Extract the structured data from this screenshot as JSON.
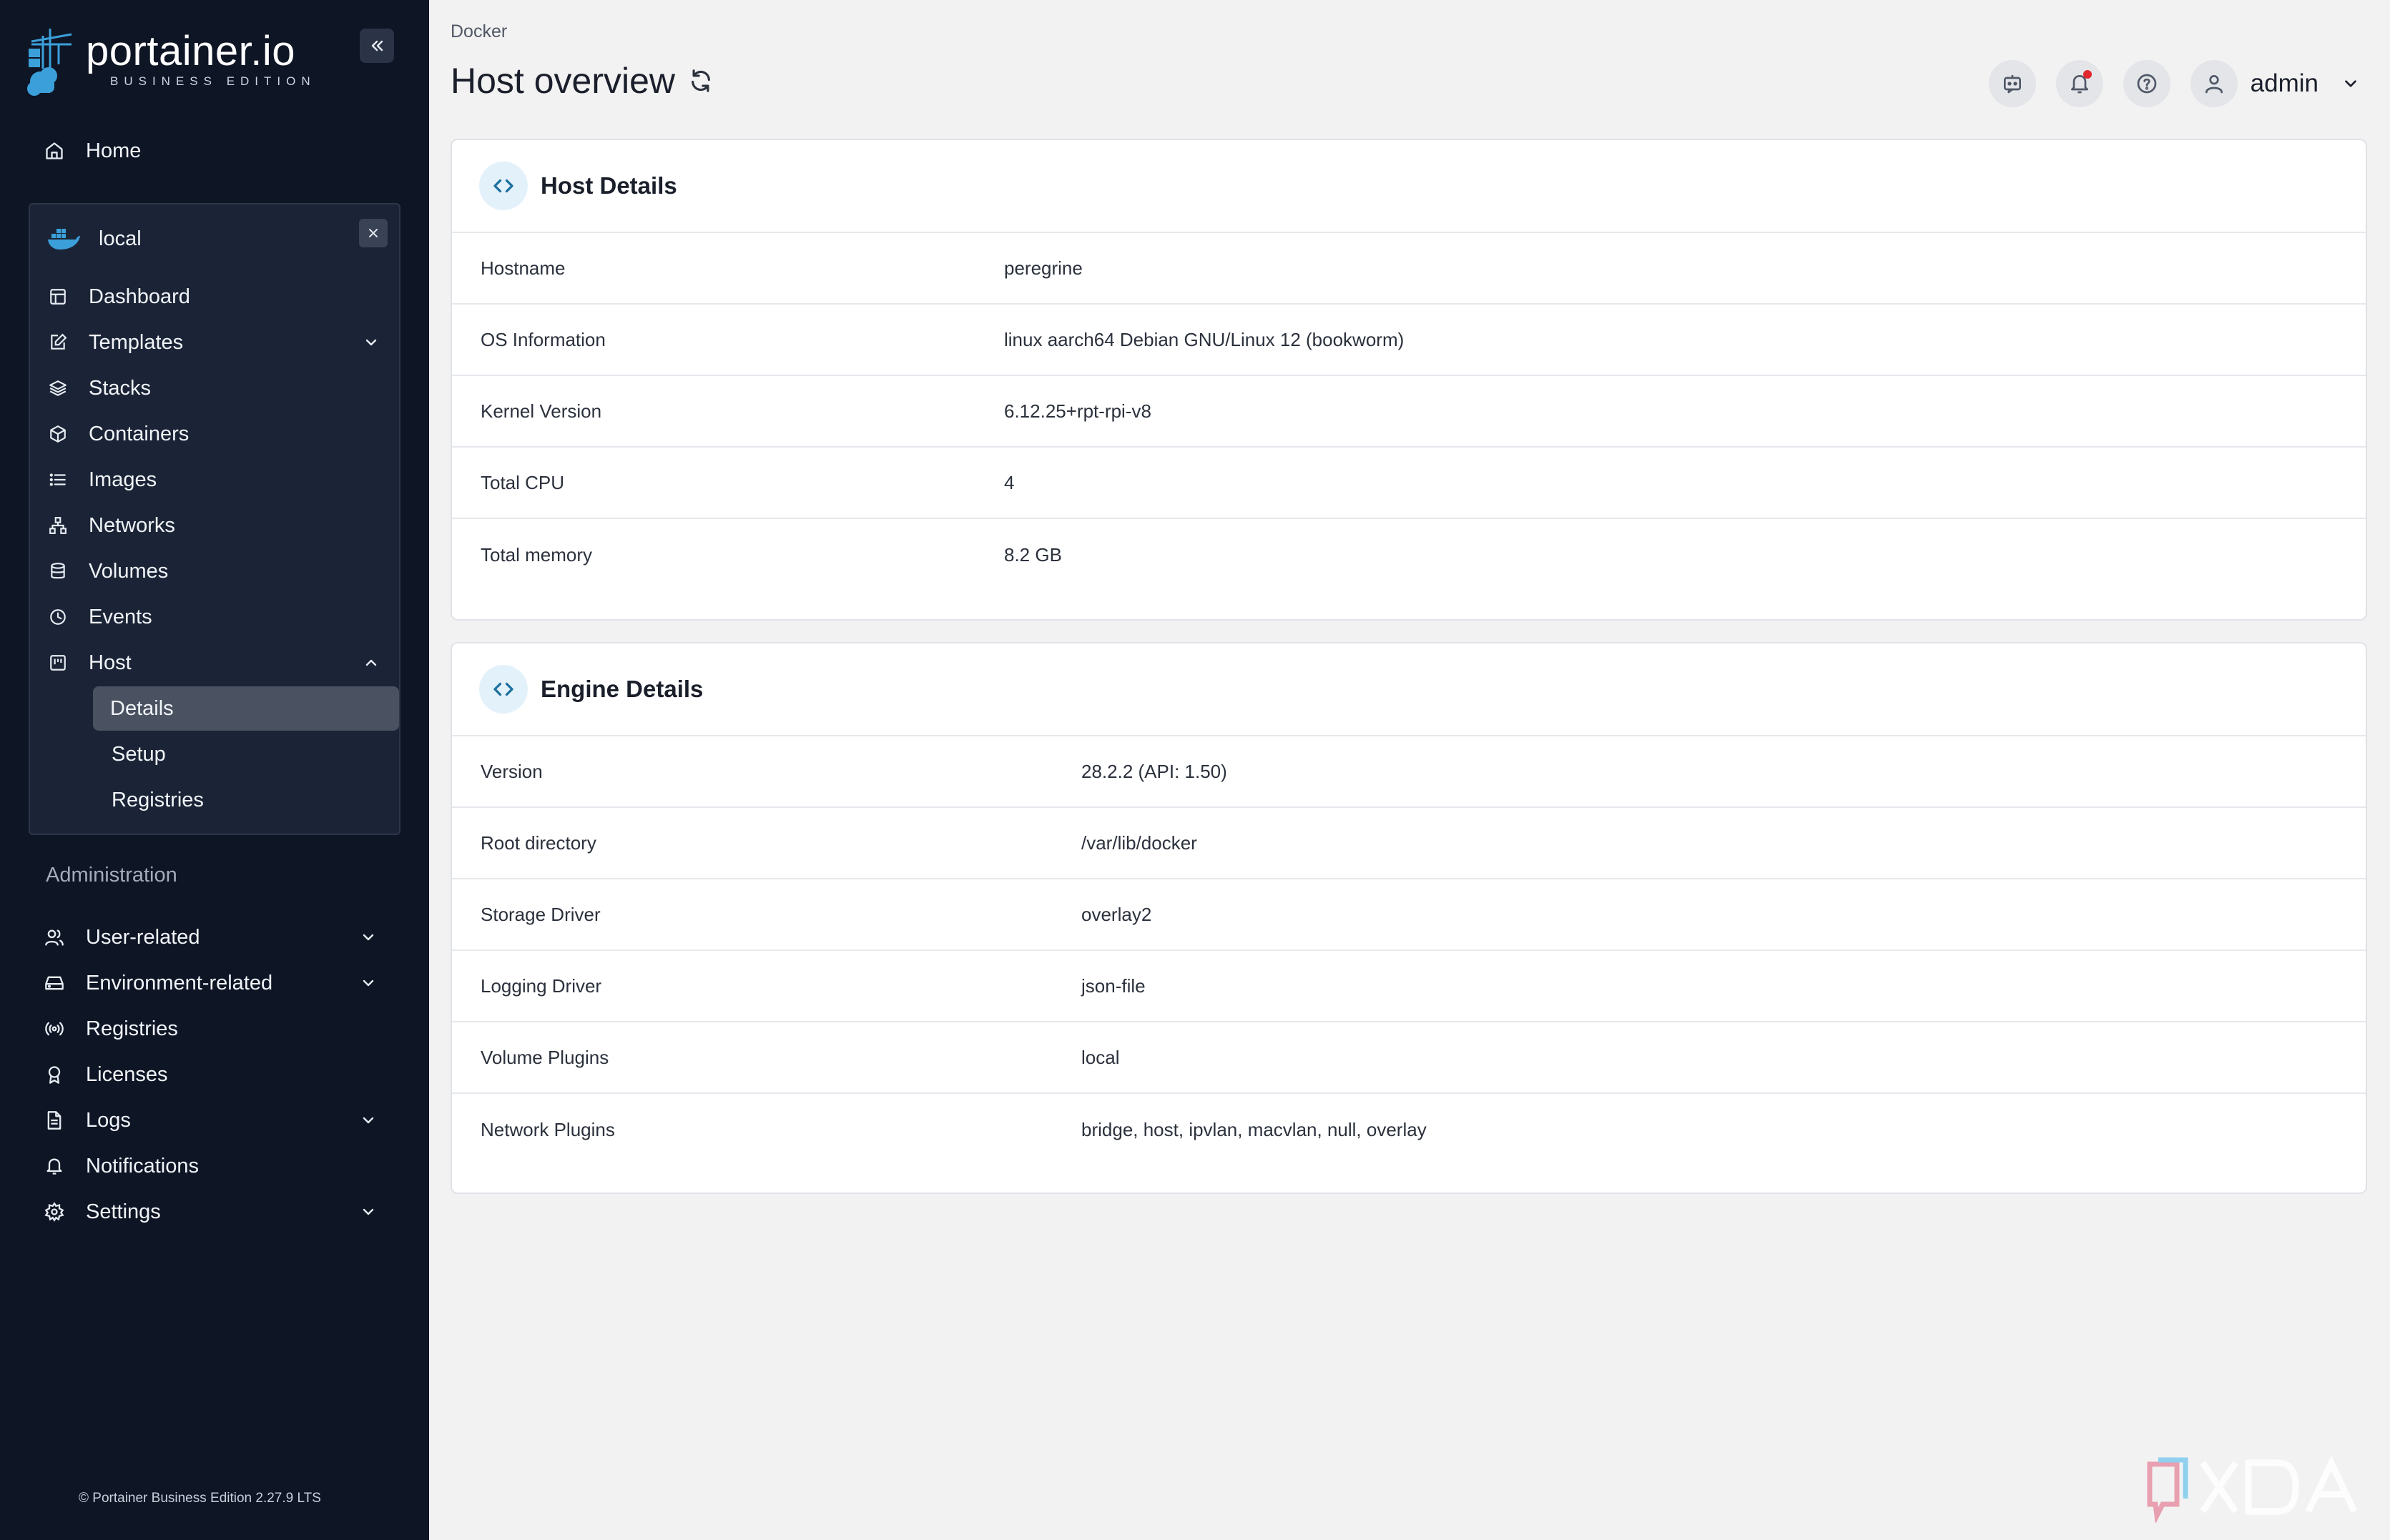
{
  "app": {
    "logo_title": "portainer.io",
    "logo_subtitle": "BUSINESS EDITION",
    "footer": "© Portainer Business Edition 2.27.9 LTS"
  },
  "sidebar": {
    "home": "Home",
    "environment": {
      "name": "local",
      "items": [
        {
          "label": "Dashboard",
          "icon": "dashboard-icon"
        },
        {
          "label": "Templates",
          "icon": "templates-icon",
          "expandable": true
        },
        {
          "label": "Stacks",
          "icon": "stacks-icon"
        },
        {
          "label": "Containers",
          "icon": "containers-icon"
        },
        {
          "label": "Images",
          "icon": "images-icon"
        },
        {
          "label": "Networks",
          "icon": "networks-icon"
        },
        {
          "label": "Volumes",
          "icon": "volumes-icon"
        },
        {
          "label": "Events",
          "icon": "events-icon"
        },
        {
          "label": "Host",
          "icon": "host-icon",
          "expanded": true
        }
      ],
      "host_subitems": [
        "Details",
        "Setup",
        "Registries"
      ],
      "active_subitem": "Details"
    },
    "admin_label": "Administration",
    "admin_items": [
      {
        "label": "User-related",
        "expandable": true
      },
      {
        "label": "Environment-related",
        "expandable": true
      },
      {
        "label": "Registries"
      },
      {
        "label": "Licenses"
      },
      {
        "label": "Logs",
        "expandable": true
      },
      {
        "label": "Notifications"
      },
      {
        "label": "Settings",
        "expandable": true
      }
    ]
  },
  "header": {
    "breadcrumb": "Docker",
    "title": "Host overview",
    "user": "admin"
  },
  "host_details": {
    "title": "Host Details",
    "rows": [
      {
        "label": "Hostname",
        "value": "peregrine"
      },
      {
        "label": "OS Information",
        "value": "linux aarch64 Debian GNU/Linux 12 (bookworm)"
      },
      {
        "label": "Kernel Version",
        "value": "6.12.25+rpt-rpi-v8"
      },
      {
        "label": "Total CPU",
        "value": "4"
      },
      {
        "label": "Total memory",
        "value": "8.2 GB"
      }
    ]
  },
  "engine_details": {
    "title": "Engine Details",
    "rows": [
      {
        "label": "Version",
        "value": "28.2.2 (API: 1.50)"
      },
      {
        "label": "Root directory",
        "value": "/var/lib/docker"
      },
      {
        "label": "Storage Driver",
        "value": "overlay2"
      },
      {
        "label": "Logging Driver",
        "value": "json-file"
      },
      {
        "label": "Volume Plugins",
        "value": "local"
      },
      {
        "label": "Network Plugins",
        "value": "bridge, host, ipvlan, macvlan, null, overlay"
      }
    ]
  },
  "colors": {
    "sidebar_bg": "#0e1525",
    "accent": "#3ba0da"
  }
}
